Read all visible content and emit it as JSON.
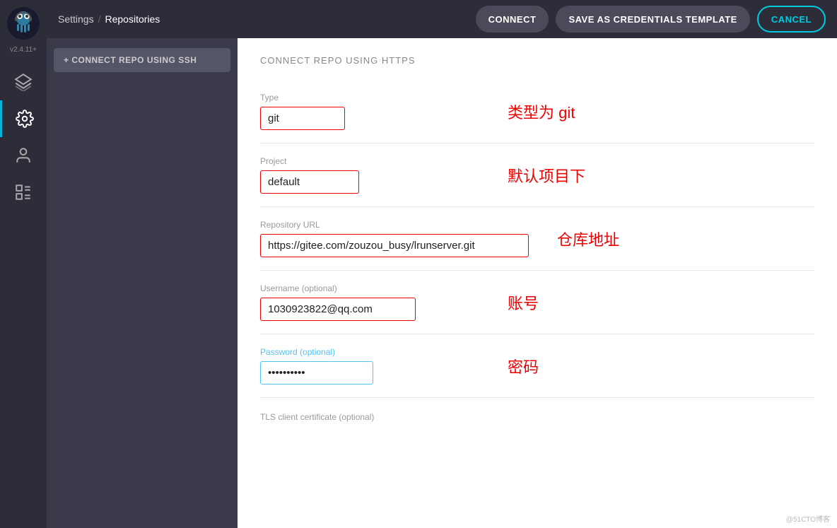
{
  "sidebar": {
    "version": "v2.4.11+",
    "items": [
      {
        "name": "layers",
        "label": "Layers",
        "active": false
      },
      {
        "name": "settings",
        "label": "Settings",
        "active": true
      },
      {
        "name": "user",
        "label": "User",
        "active": false
      },
      {
        "name": "list",
        "label": "List",
        "active": false
      }
    ]
  },
  "breadcrumb": {
    "parent": "Settings",
    "separator": "/",
    "current": "Repositories"
  },
  "topbar": {
    "connect_label": "CONNECT",
    "save_template_label": "SAVE AS CREDENTIALS TEMPLATE",
    "cancel_label": "CANCEL"
  },
  "sub_sidebar": {
    "connect_ssh_label": "+ CONNECT REPO USING SSH"
  },
  "form": {
    "title": "CONNECT REPO USING HTTPS",
    "fields": [
      {
        "label": "Type",
        "value": "git",
        "annotation": "类型为 git",
        "type": "text",
        "wide": false,
        "focus": false
      },
      {
        "label": "Project",
        "value": "default",
        "annotation": "默认项目下",
        "type": "text",
        "wide": false,
        "focus": false
      },
      {
        "label": "Repository URL",
        "value": "https://gitee.com/zouzou_busy/lrunserver.git",
        "annotation": "仓库地址",
        "type": "text",
        "wide": true,
        "focus": false
      },
      {
        "label": "Username (optional)",
        "value": "1030923822@qq.com",
        "annotation": "账号",
        "type": "text",
        "wide": false,
        "focus": false
      },
      {
        "label": "Password (optional)",
        "value": "••••••••••",
        "annotation": "密码",
        "type": "password",
        "wide": false,
        "focus": true
      }
    ],
    "tls_label": "TLS client certificate (optional)"
  },
  "watermark": "@51CTO博客"
}
